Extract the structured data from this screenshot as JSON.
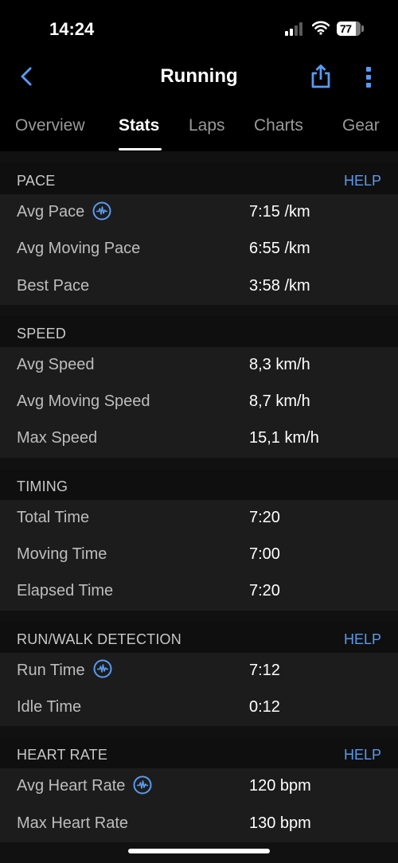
{
  "status_bar": {
    "time": "14:24",
    "battery_level": "77",
    "icons": [
      "cellular-signal-icon",
      "wifi-icon",
      "battery-icon"
    ]
  },
  "nav": {
    "title": "Running",
    "back_icon": "chevron-left-icon",
    "share_icon": "share-icon",
    "more_icon": "more-vertical-icon"
  },
  "tabs": [
    {
      "label": "Overview",
      "active": false
    },
    {
      "label": "Stats",
      "active": true
    },
    {
      "label": "Laps",
      "active": false
    },
    {
      "label": "Charts",
      "active": false
    },
    {
      "label": "Gear",
      "active": false
    }
  ],
  "colors": {
    "accent": "#5a9af0",
    "background": "#111111",
    "row_background": "#1c1c1c",
    "header_background": "#000000"
  },
  "sections": [
    {
      "title": "PACE",
      "help": "HELP",
      "rows": [
        {
          "label": "Avg Pace",
          "value": "7:15 /km",
          "icon": "pulse-chart-icon"
        },
        {
          "label": "Avg Moving Pace",
          "value": "6:55 /km"
        },
        {
          "label": "Best Pace",
          "value": "3:58 /km"
        }
      ]
    },
    {
      "title": "SPEED",
      "rows": [
        {
          "label": "Avg Speed",
          "value": "8,3 km/h"
        },
        {
          "label": "Avg Moving Speed",
          "value": "8,7 km/h"
        },
        {
          "label": "Max Speed",
          "value": "15,1 km/h"
        }
      ]
    },
    {
      "title": "TIMING",
      "rows": [
        {
          "label": "Total Time",
          "value": "7:20"
        },
        {
          "label": "Moving Time",
          "value": "7:00"
        },
        {
          "label": "Elapsed Time",
          "value": "7:20"
        }
      ]
    },
    {
      "title": "RUN/WALK DETECTION",
      "help": "HELP",
      "rows": [
        {
          "label": "Run Time",
          "value": "7:12",
          "icon": "pulse-chart-icon"
        },
        {
          "label": "Idle Time",
          "value": "0:12"
        }
      ]
    },
    {
      "title": "HEART RATE",
      "help": "HELP",
      "rows": [
        {
          "label": "Avg Heart Rate",
          "value": "120 bpm",
          "icon": "pulse-chart-icon"
        },
        {
          "label": "Max Heart Rate",
          "value": "130 bpm"
        }
      ]
    }
  ]
}
